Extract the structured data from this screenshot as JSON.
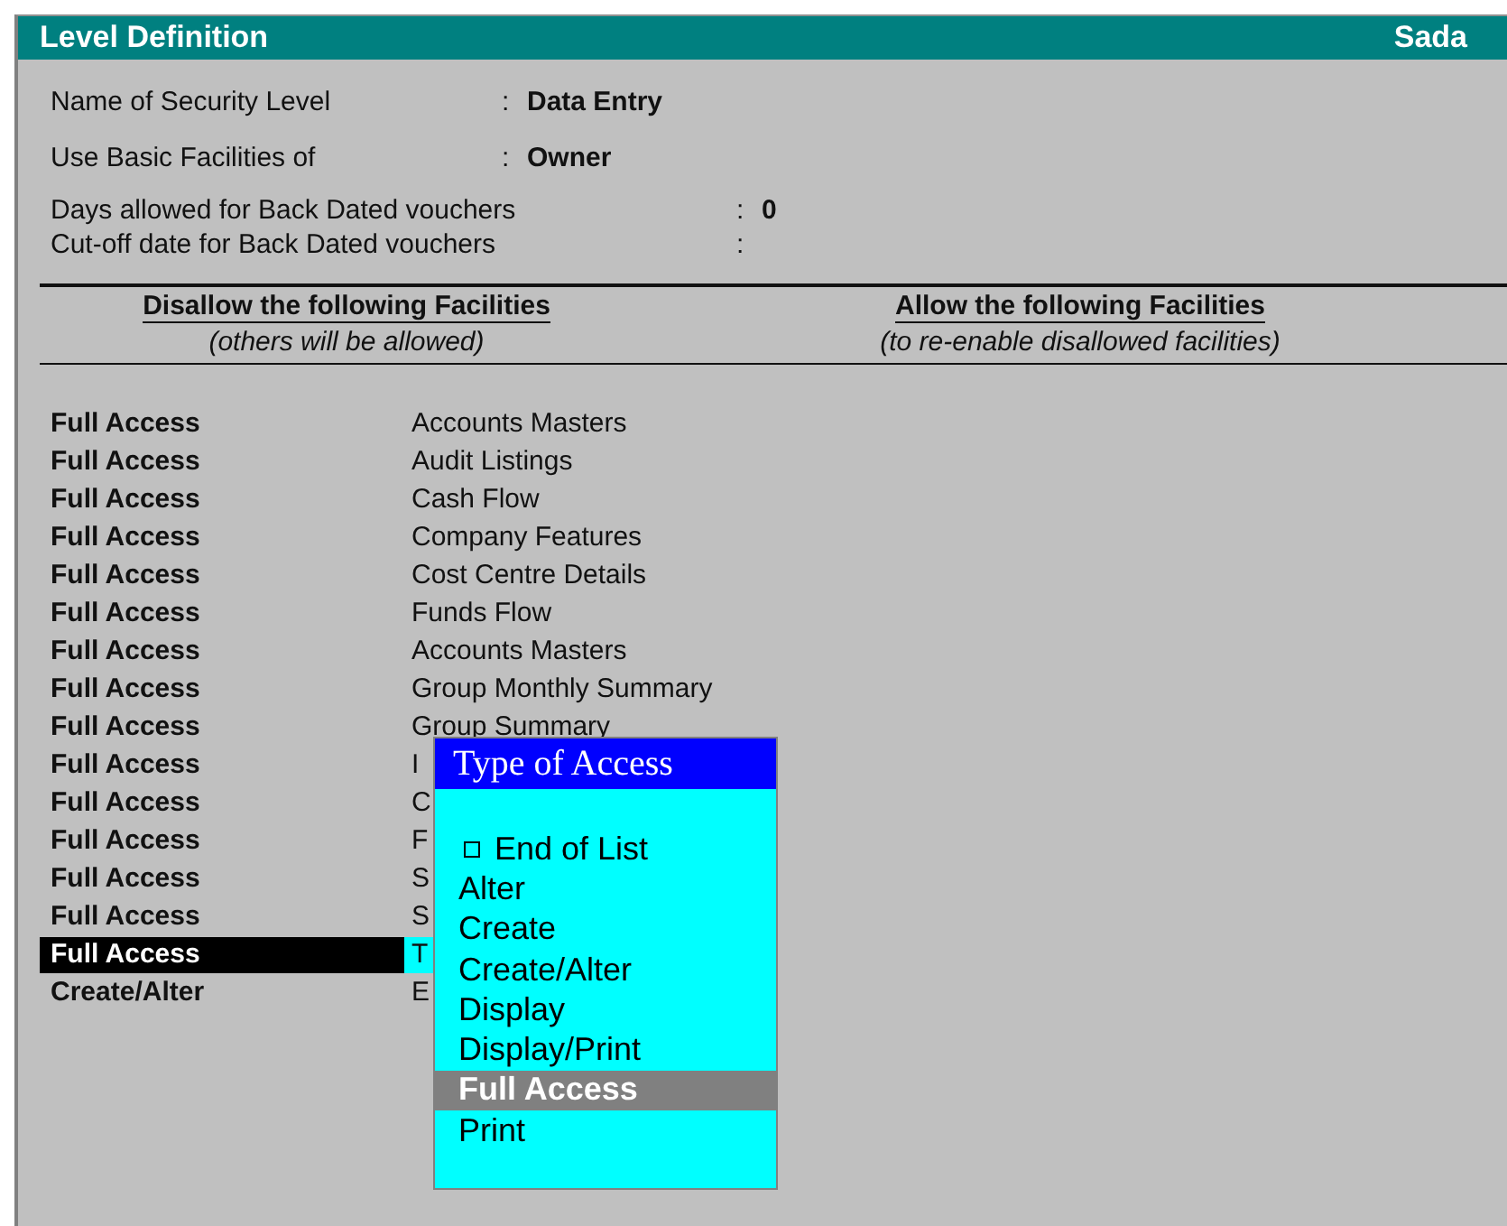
{
  "window": {
    "title": "Level Definition",
    "company": "Sada"
  },
  "fields": [
    {
      "label": "Name of Security Level",
      "value": "Data Entry",
      "kind": "spaced"
    },
    {
      "label": "Use Basic Facilities of",
      "value": "Owner",
      "kind": "spaced"
    },
    {
      "label": "Days allowed for Back Dated vouchers",
      "value": "0",
      "kind": "tight"
    },
    {
      "label": "Cut-off date for Back Dated vouchers",
      "kind": "tight"
    }
  ],
  "separator": ":",
  "columns": [
    {
      "heading": "Disallow the following Facilities",
      "note": "(others will be allowed)"
    },
    {
      "heading": "Allow the following Facilities",
      "note": "(to re-enable disallowed facilities)"
    }
  ],
  "rows": [
    {
      "access": "Full Access",
      "facility": "Accounts Masters",
      "selected": false
    },
    {
      "access": "Full Access",
      "facility": "Audit Listings",
      "selected": false
    },
    {
      "access": "Full Access",
      "facility": "Cash Flow",
      "selected": false
    },
    {
      "access": "Full Access",
      "facility": "Company Features",
      "selected": false
    },
    {
      "access": "Full Access",
      "facility": "Cost Centre Details",
      "selected": false
    },
    {
      "access": "Full Access",
      "facility": "Funds Flow",
      "selected": false
    },
    {
      "access": "Full Access",
      "facility": "Accounts Masters",
      "selected": false
    },
    {
      "access": "Full Access",
      "facility": "Group Monthly Summary",
      "selected": false
    },
    {
      "access": "Full Access",
      "facility": "Group Summary",
      "selected": false
    },
    {
      "access": "Full Access",
      "facility": "I",
      "selected": false
    },
    {
      "access": "Full Access",
      "facility": "C",
      "selected": false
    },
    {
      "access": "Full Access",
      "facility": "F",
      "selected": false
    },
    {
      "access": "Full Access",
      "facility": "S",
      "selected": false
    },
    {
      "access": "Full Access",
      "facility": "S",
      "selected": false
    },
    {
      "access": "Full Access",
      "facility": "T",
      "selected": true
    },
    {
      "access": "Create/Alter",
      "facility": "E",
      "selected": false
    }
  ],
  "popup": {
    "title": "Type of Access",
    "items": [
      {
        "label": "End of List",
        "kind": "end",
        "selected": false
      },
      {
        "label": "Alter",
        "kind": "option",
        "selected": false
      },
      {
        "label": "Create",
        "kind": "option",
        "selected": false
      },
      {
        "label": "Create/Alter",
        "kind": "option",
        "selected": false
      },
      {
        "label": "Display",
        "kind": "option",
        "selected": false
      },
      {
        "label": "Display/Print",
        "kind": "option",
        "selected": false
      },
      {
        "label": "Full Access",
        "kind": "option",
        "selected": true
      },
      {
        "label": "Print",
        "kind": "option",
        "selected": false
      }
    ]
  }
}
